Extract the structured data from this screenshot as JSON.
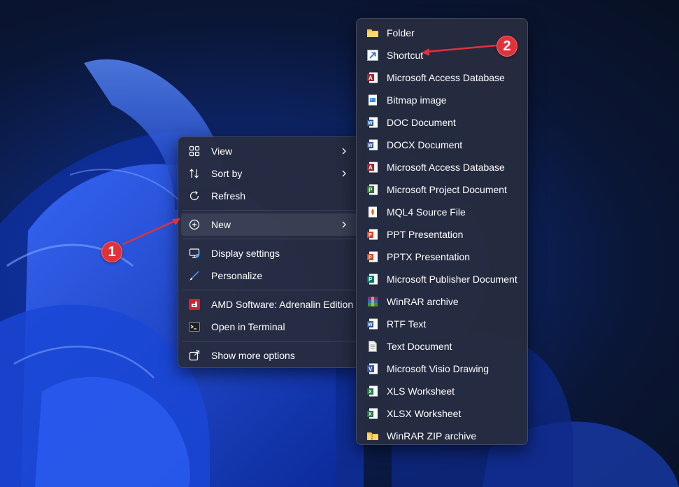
{
  "context_menu": {
    "items": [
      {
        "label": "View",
        "icon": "grid-icon"
      },
      {
        "label": "Sort by",
        "icon": "sort-icon"
      },
      {
        "label": "Refresh",
        "icon": "refresh-icon"
      },
      {
        "label": "New",
        "icon": "plus-circle-icon"
      },
      {
        "label": "Display settings",
        "icon": "display-icon"
      },
      {
        "label": "Personalize",
        "icon": "brush-icon"
      },
      {
        "label": "AMD Software: Adrenalin Edition",
        "icon": "amd-icon"
      },
      {
        "label": "Open in Terminal",
        "icon": "terminal-icon"
      },
      {
        "label": "Show more options",
        "icon": "share-icon"
      }
    ]
  },
  "new_submenu": {
    "items": [
      {
        "label": "Folder",
        "icon": "folder-icon",
        "color": "#f6c342"
      },
      {
        "label": "Shortcut",
        "icon": "shortcut-icon",
        "color": "#1f6fd1"
      },
      {
        "label": "Microsoft Access Database",
        "icon": "access-icon",
        "color": "#a4262c"
      },
      {
        "label": "Bitmap image",
        "icon": "bitmap-icon",
        "color": "#3a8ee6"
      },
      {
        "label": "DOC Document",
        "icon": "word-icon",
        "color": "#2b579a"
      },
      {
        "label": "DOCX Document",
        "icon": "word-icon",
        "color": "#2b579a"
      },
      {
        "label": "Microsoft Access Database",
        "icon": "access-icon",
        "color": "#a4262c"
      },
      {
        "label": "Microsoft Project Document",
        "icon": "project-icon",
        "color": "#31752f"
      },
      {
        "label": "MQL4 Source File",
        "icon": "mql4-icon",
        "color": "#e8682a"
      },
      {
        "label": "PPT Presentation",
        "icon": "powerpoint-icon",
        "color": "#d24726"
      },
      {
        "label": "PPTX Presentation",
        "icon": "powerpoint-icon",
        "color": "#d24726"
      },
      {
        "label": "Microsoft Publisher Document",
        "icon": "publisher-icon",
        "color": "#077568"
      },
      {
        "label": "WinRAR archive",
        "icon": "winrar-icon",
        "color": "#8b2a7d"
      },
      {
        "label": "RTF Text",
        "icon": "rtf-icon",
        "color": "#2b579a"
      },
      {
        "label": "Text Document",
        "icon": "text-document-icon",
        "color": "#e8e8e8"
      },
      {
        "label": "Microsoft Visio Drawing",
        "icon": "visio-icon",
        "color": "#3955a3"
      },
      {
        "label": "XLS Worksheet",
        "icon": "excel-icon",
        "color": "#217346"
      },
      {
        "label": "XLSX Worksheet",
        "icon": "excel-icon",
        "color": "#217346"
      },
      {
        "label": "WinRAR ZIP archive",
        "icon": "zip-icon",
        "color": "#f6c342"
      }
    ]
  },
  "annotations": {
    "badge_1": "1",
    "badge_2": "2",
    "arrow_color": "#e0323a"
  }
}
